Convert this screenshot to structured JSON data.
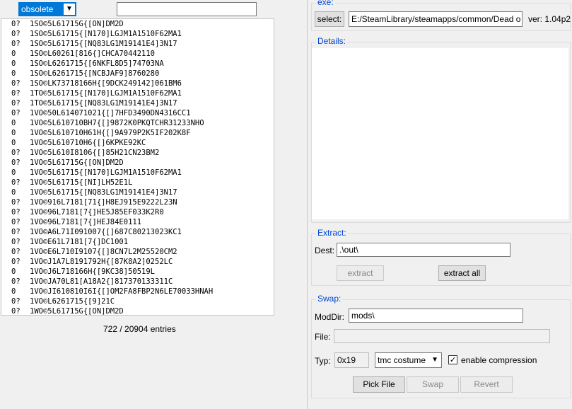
{
  "left": {
    "filter": {
      "selected": "obsolete"
    },
    "search": {
      "value": ""
    },
    "entries": [
      {
        "status": "0?",
        "name": "1SO©5L61715G{[ON]DM2D"
      },
      {
        "status": "0?",
        "name": "1SO©5L61715{[N170]LGJM1A1510F62MA1"
      },
      {
        "status": "0?",
        "name": "1SO©5L61715{[NQ83LG1M19141E4]3N17"
      },
      {
        "status": "0",
        "name": "1SO©L60261[816{]CHCA70442110"
      },
      {
        "status": "0",
        "name": "1SO©L6261715{[6NKFL8D5]74703NA"
      },
      {
        "status": "0",
        "name": "1SO©L6261715{[NCBJAF9]8760280"
      },
      {
        "status": "0?",
        "name": "1SO©LK73718166H{[9DCK249142]061BM6"
      },
      {
        "status": "0?",
        "name": "1TO©5L61715{[N170]LGJM1A1510F62MA1"
      },
      {
        "status": "0?",
        "name": "1TO©5L61715{[NQ83LG1M19141E4]3N17"
      },
      {
        "status": "0?",
        "name": "1VO©50L614071021{[]7HFD3490DN4316CC1"
      },
      {
        "status": "0",
        "name": "1VO©5L610710BH7{[]9872K0PKQTCHR31233NHO"
      },
      {
        "status": "0",
        "name": "1VO©5L610710H61H{[]9A979P2K5IF202K8F"
      },
      {
        "status": "0",
        "name": "1VO©5L610710H6{[]6KPKE92KC"
      },
      {
        "status": "0?",
        "name": "1VO©5L610I8106{[]85H21CN23BM2"
      },
      {
        "status": "0?",
        "name": "1VO©5L61715G{[ON]DM2D"
      },
      {
        "status": "0",
        "name": "1VO©5L61715{[N170]LGJM1A1510F62MA1"
      },
      {
        "status": "0?",
        "name": "1VO©5L61715{[NI]LH52E1L"
      },
      {
        "status": "0",
        "name": "1VO©5L61715{[NQ83LG1M19141E4]3N17"
      },
      {
        "status": "0?",
        "name": "1VO©916L7181[71{]H8EJ915E9222L23N"
      },
      {
        "status": "0?",
        "name": "1VO©96L7181[7{]HE5J85EF033K2R0"
      },
      {
        "status": "0?",
        "name": "1VO©96L7181[7{]HEJ84E0111"
      },
      {
        "status": "0?",
        "name": "1VO©A6L71I091007{[]687C80213023KC1"
      },
      {
        "status": "0?",
        "name": "1VO©E61L7181[7{]DC1001"
      },
      {
        "status": "0?",
        "name": "1VO©E6L710I9107{[]8CN7L2M25520CM2"
      },
      {
        "status": "0?",
        "name": "1VO©J1A7L8191792H{[87K8A2]0252LC"
      },
      {
        "status": "0",
        "name": "1VO©J6L718166H{[9KC38]50519L"
      },
      {
        "status": "0?",
        "name": "1VO©JA70L81[A18A2{]817370133311C"
      },
      {
        "status": "0",
        "name": "1VO©JI610810I6I{[]OM2FA8FBP2N6LE70033HNAH"
      },
      {
        "status": "0?",
        "name": "1VO©L6261715{[9]21C"
      },
      {
        "status": "0?",
        "name": "1WO©5L61715G{[ON]DM2D"
      }
    ],
    "count_text": "722 / 20904 entries"
  },
  "exe": {
    "legend": "exe:",
    "select_label": "select:",
    "path": "E:/SteamLibrary/steamapps/common/Dead o",
    "version": "ver: 1.04p2"
  },
  "details": {
    "legend": "Details:"
  },
  "extract": {
    "legend": "Extract:",
    "dest_label": "Dest:",
    "dest_value": ".\\out\\",
    "extract_label": "extract",
    "extract_all_label": "extract all"
  },
  "swap": {
    "legend": "Swap:",
    "moddir_label": "ModDir:",
    "moddir_value": "mods\\",
    "file_label": "File:",
    "file_value": "",
    "typ_label": "Typ:",
    "typ_value": "0x19",
    "costume_selected": "tmc costume",
    "compression_label": "enable compression",
    "compression_checked": true,
    "pick_file_label": "Pick File",
    "swap_label": "Swap",
    "revert_label": "Revert"
  }
}
